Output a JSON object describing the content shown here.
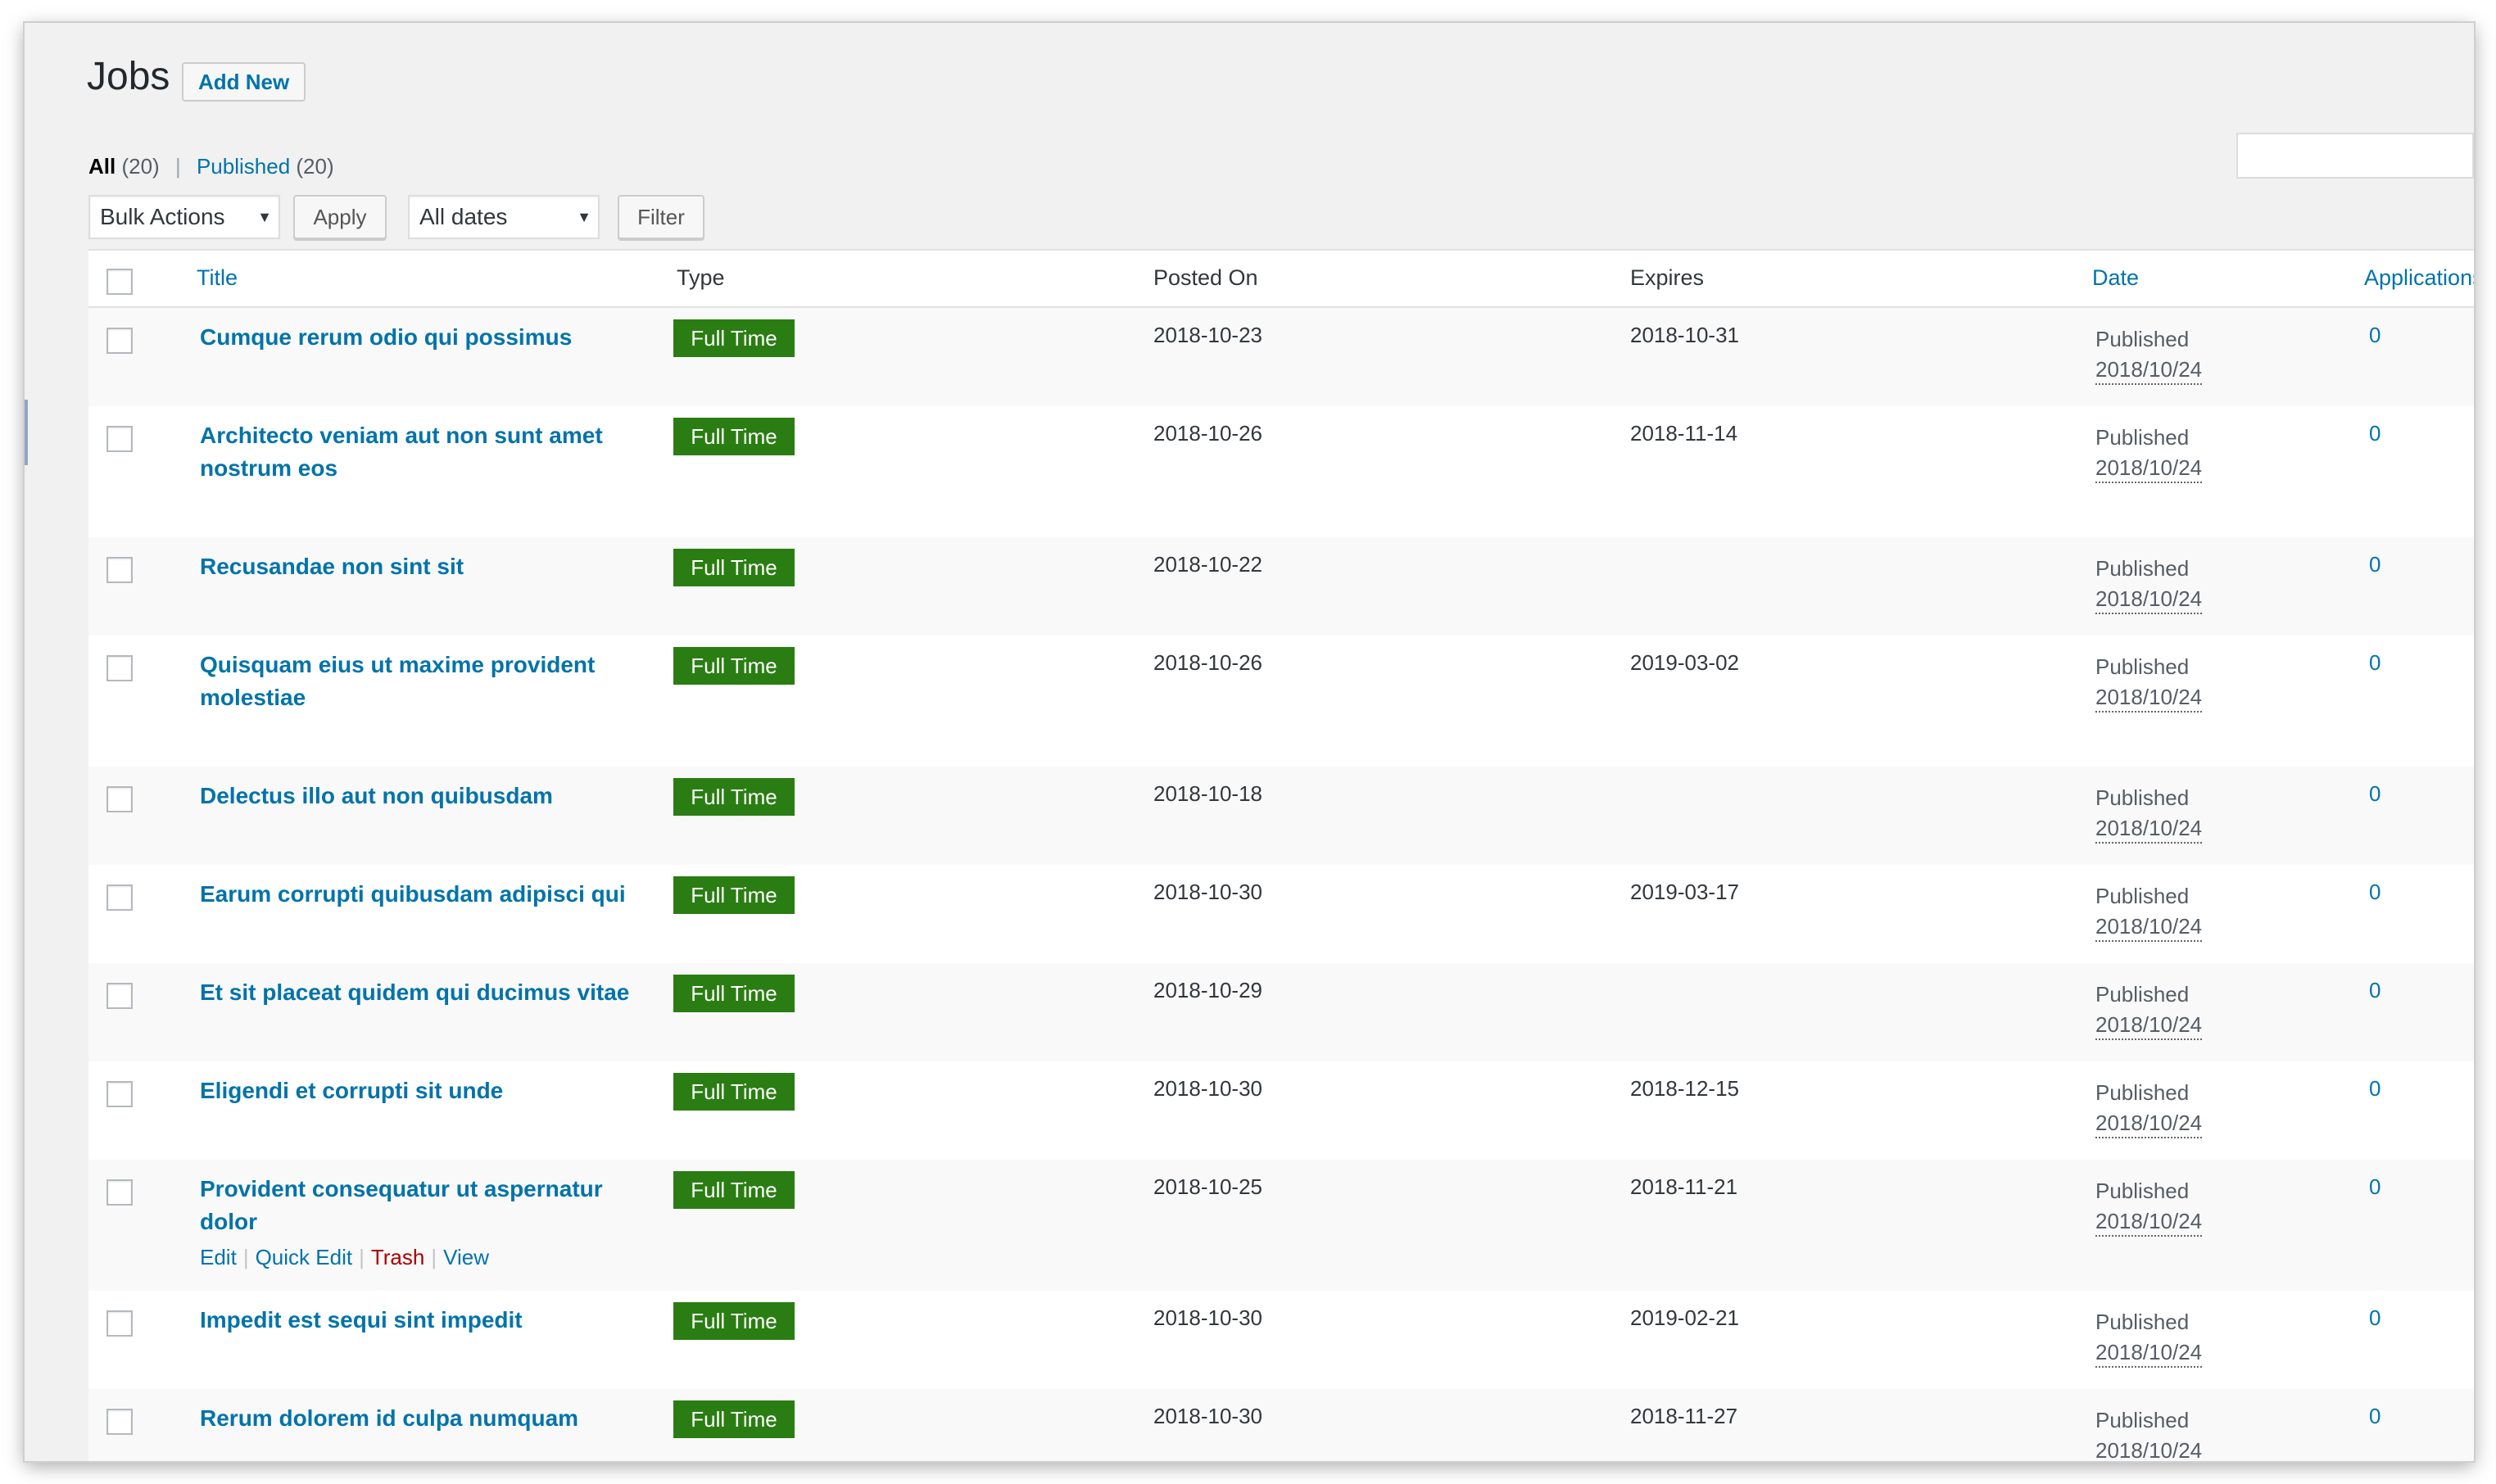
{
  "header": {
    "title": "Jobs",
    "add_new_label": "Add New"
  },
  "views": {
    "all_label": "All",
    "all_count": "(20)",
    "published_label": "Published",
    "published_count": "(20)",
    "separator": "|"
  },
  "tablenav": {
    "bulk_actions": "Bulk Actions",
    "apply_label": "Apply",
    "dates": "All dates",
    "filter_label": "Filter"
  },
  "columns": {
    "title": "Title",
    "type": "Type",
    "posted_on": "Posted On",
    "expires": "Expires",
    "date": "Date",
    "applications": "Applications"
  },
  "rows": [
    {
      "title": "Cumque rerum odio qui possimus",
      "type": "Full Time",
      "posted_on": "2018-10-23",
      "expires": "2018-10-31",
      "status": "Published",
      "date": "2018/10/24",
      "applications": "0"
    },
    {
      "title": "Architecto veniam aut non sunt amet nostrum eos",
      "type": "Full Time",
      "posted_on": "2018-10-26",
      "expires": "2018-11-14",
      "status": "Published",
      "date": "2018/10/24",
      "applications": "0"
    },
    {
      "title": "Recusandae non sint sit",
      "type": "Full Time",
      "posted_on": "2018-10-22",
      "expires": "",
      "status": "Published",
      "date": "2018/10/24",
      "applications": "0"
    },
    {
      "title": "Quisquam eius ut maxime provident molestiae",
      "type": "Full Time",
      "posted_on": "2018-10-26",
      "expires": "2019-03-02",
      "status": "Published",
      "date": "2018/10/24",
      "applications": "0"
    },
    {
      "title": "Delectus illo aut non quibusdam",
      "type": "Full Time",
      "posted_on": "2018-10-18",
      "expires": "",
      "status": "Published",
      "date": "2018/10/24",
      "applications": "0"
    },
    {
      "title": "Earum corrupti quibusdam adipisci qui",
      "type": "Full Time",
      "posted_on": "2018-10-30",
      "expires": "2019-03-17",
      "status": "Published",
      "date": "2018/10/24",
      "applications": "0"
    },
    {
      "title": "Et sit placeat quidem qui ducimus vitae",
      "type": "Full Time",
      "posted_on": "2018-10-29",
      "expires": "",
      "status": "Published",
      "date": "2018/10/24",
      "applications": "0"
    },
    {
      "title": "Eligendi et corrupti sit unde",
      "type": "Full Time",
      "posted_on": "2018-10-30",
      "expires": "2018-12-15",
      "status": "Published",
      "date": "2018/10/24",
      "applications": "0"
    },
    {
      "title": "Provident consequatur ut aspernatur dolor",
      "type": "Full Time",
      "posted_on": "2018-10-25",
      "expires": "2018-11-21",
      "status": "Published",
      "date": "2018/10/24",
      "applications": "0"
    },
    {
      "title": "Impedit est sequi sint impedit",
      "type": "Full Time",
      "posted_on": "2018-10-30",
      "expires": "2019-02-21",
      "status": "Published",
      "date": "2018/10/24",
      "applications": "0"
    },
    {
      "title": "Rerum dolorem id culpa numquam",
      "type": "Full Time",
      "posted_on": "2018-10-30",
      "expires": "2018-11-27",
      "status": "Published",
      "date": "2018/10/24",
      "applications": "0"
    }
  ],
  "row_actions": {
    "edit": "Edit",
    "quick_edit": "Quick Edit",
    "trash": "Trash",
    "view": "View",
    "separator": "|"
  }
}
